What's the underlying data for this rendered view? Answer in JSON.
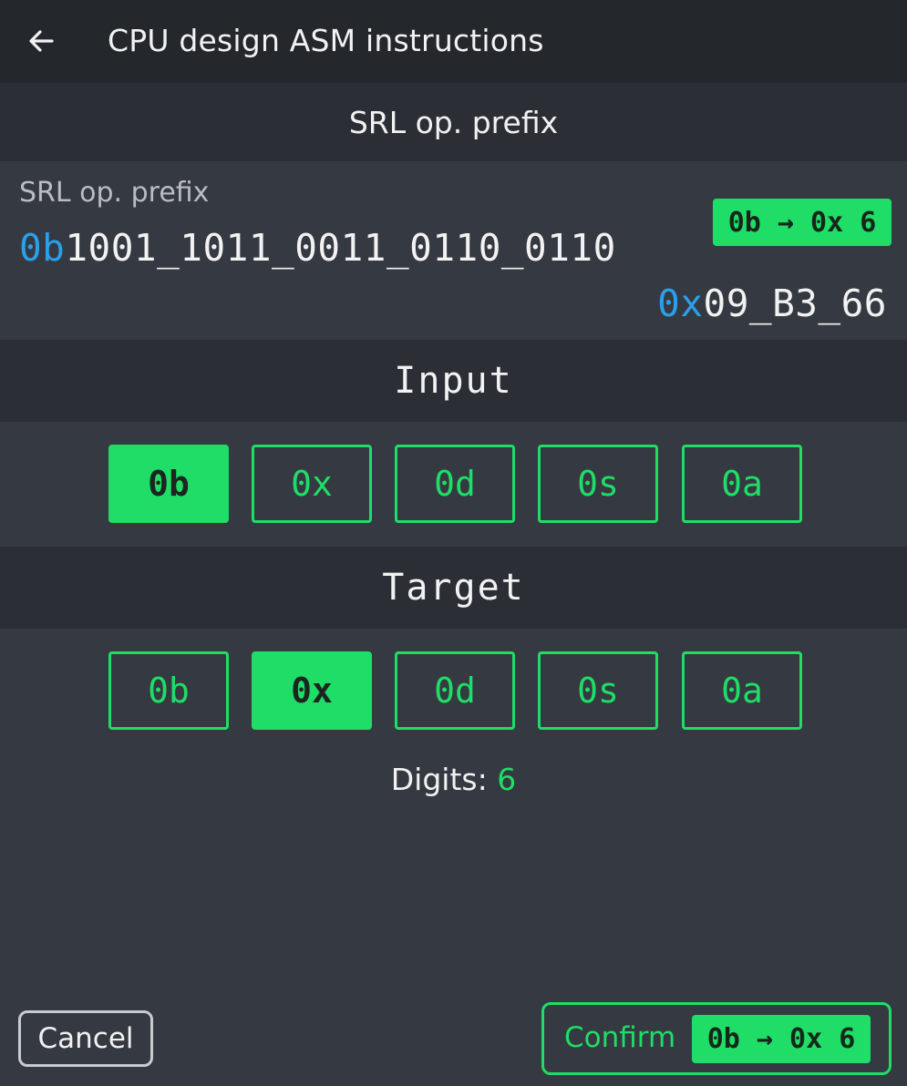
{
  "appbar": {
    "title": "CPU design ASM instructions",
    "back_icon": "arrow-left-icon"
  },
  "prefix_section": {
    "header": "SRL op. prefix",
    "label": "SRL op. prefix",
    "binary": {
      "prefix": "0b",
      "value": "1001_1011_0011_0110_0110"
    },
    "hex": {
      "prefix": "0x",
      "value": "09_B3_66"
    },
    "badge": "0b → 0x 6"
  },
  "input_section": {
    "header": "Input",
    "options": [
      "0b",
      "0x",
      "0d",
      "0s",
      "0a"
    ],
    "selected": "0b"
  },
  "target_section": {
    "header": "Target",
    "options": [
      "0b",
      "0x",
      "0d",
      "0s",
      "0a"
    ],
    "selected": "0x"
  },
  "digits": {
    "label": "Digits:",
    "value": "6"
  },
  "footer": {
    "cancel_label": "Cancel",
    "confirm_label": "Confirm",
    "confirm_badge": "0b → 0x 6"
  },
  "colors": {
    "accent": "#1fdd66",
    "prefix_blue": "#2aa0ea",
    "background": "#353941",
    "header_bg": "#2b2f35",
    "appbar_bg": "#24272c"
  }
}
